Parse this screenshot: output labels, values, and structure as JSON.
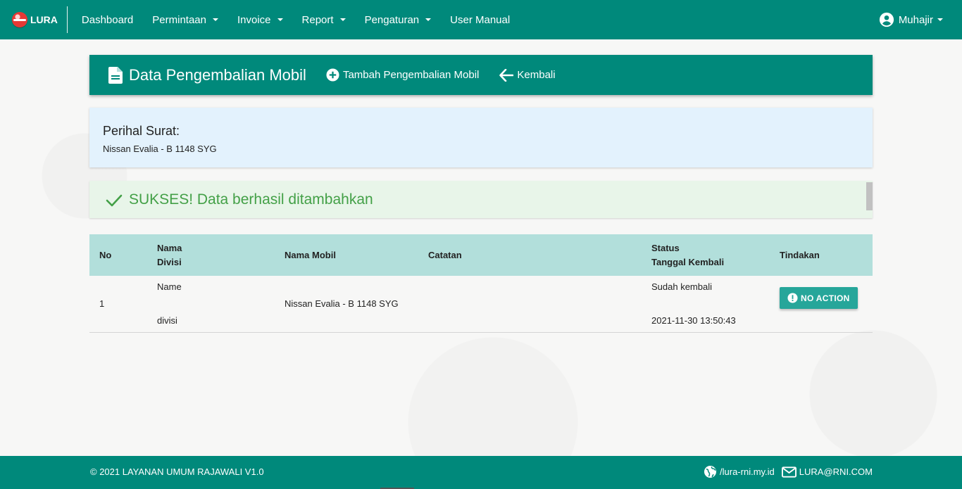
{
  "navbar": {
    "brand": "LURA",
    "items": [
      {
        "label": "Dashboard",
        "has_caret": false
      },
      {
        "label": "Permintaan",
        "has_caret": true
      },
      {
        "label": "Invoice",
        "has_caret": true
      },
      {
        "label": "Report",
        "has_caret": true
      },
      {
        "label": "Pengaturan",
        "has_caret": true
      },
      {
        "label": "User Manual",
        "has_caret": false
      }
    ],
    "user": "Muhajir"
  },
  "header": {
    "title": "Data Pengembalian Mobil",
    "add_label": "Tambah Pengembalian Mobil",
    "back_label": "Kembali"
  },
  "perihal": {
    "label": "Perihal Surat:",
    "value": "Nissan Evalia - B 1148 SYG"
  },
  "alert": {
    "text": "SUKSES! Data berhasil ditambahkan"
  },
  "table": {
    "headers": {
      "no": "No",
      "nama_divisi_1": "Nama",
      "nama_divisi_2": "Divisi",
      "nama_mobil": "Nama Mobil",
      "catatan": "Catatan",
      "status_1": "Status",
      "status_2": "Tanggal Kembali",
      "tindakan": "Tindakan"
    },
    "rows": [
      {
        "no": "1",
        "nama": "Name",
        "divisi": "divisi",
        "nama_mobil": "Nissan Evalia - B 1148 SYG",
        "catatan": "",
        "status": "Sudah kembali",
        "tanggal_kembali": "2021-11-30 13:50:43",
        "action_label": "NO ACTION"
      }
    ]
  },
  "footer": {
    "copyright": "© 2021 LAYANAN UMUM RAJAWALI V1.0",
    "website": "/lura-rni.my.id",
    "email": "LURA@RNI.COM"
  },
  "colors": {
    "primary": "#00897b",
    "table_header": "#b2dfdb",
    "info_bg": "#e3f2fd",
    "success_bg": "#e8f5e9",
    "success_text": "#43a047",
    "button": "#26a69a"
  },
  "icons": {
    "brand": "lura-logo-icon",
    "user": "account-circle-icon",
    "title": "document-icon",
    "add": "add-circle-icon",
    "back": "arrow-left-icon",
    "alert": "check-icon",
    "action": "alert-circle-icon",
    "website": "globe-icon",
    "email": "mail-icon"
  }
}
